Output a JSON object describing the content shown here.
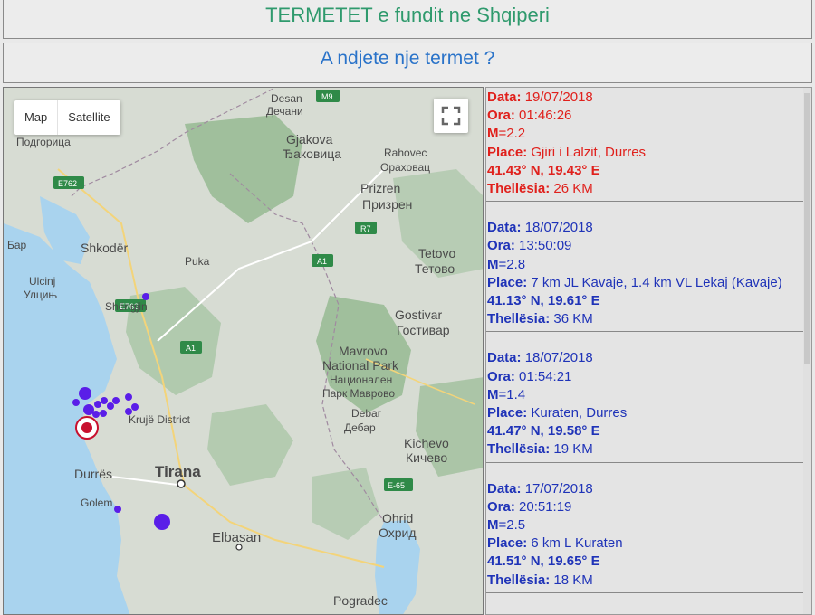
{
  "header": {
    "title": "TERMETET e fundit ne Shqiperi",
    "feel_link": "A ndjete nje termet ?"
  },
  "map": {
    "toggle": [
      "Map",
      "Satellite"
    ],
    "labels": {
      "desan": "Desan",
      "dechani": "Дечани",
      "podgorica": "Подгорица",
      "gjakova": "Gjakova",
      "djakovica": "Ђаковица",
      "rahovec": "Rahovec",
      "orahovac": "Ораховац",
      "prizren": "Prizren",
      "prizren_cyr": "Призрен",
      "shkoder": "Shkodër",
      "bar": "Бар",
      "puka": "Puka",
      "ulcinj": "Ulcinj",
      "ulcinj_cyr": "Улцињ",
      "tetovo": "Tetovo",
      "tetovo_cyr": "Тетово",
      "gostivar": "Gostivar",
      "gostivar_cyr": "Гостивар",
      "shengjin": "Shëngjin",
      "mavrovo1": "Mavrovo",
      "mavrovo2": "National Park",
      "mavrovo3": "Национален",
      "mavrovo4": "Парк Маврово",
      "kruje": "Krujë District",
      "debar": "Debar",
      "debar_cyr": "Дебар",
      "kichevo": "Kichevo",
      "kichevo_cyr": "Кичево",
      "durres": "Durrës",
      "tirana": "Tirana",
      "golem": "Golem",
      "ohrid": "Ohrid",
      "ohrid_cyr": "Охрид",
      "elbasan": "Elbasan",
      "pogradec": "Pogradec"
    },
    "roads": {
      "m9": "M9",
      "e762a": "E762",
      "e762b": "E762",
      "r7": "R7",
      "a1a": "A1",
      "a1b": "A1",
      "e65": "E-65"
    },
    "colors": {
      "marker": "#5a1ee8",
      "latest_marker": "#c8102e",
      "road_shield": "#2f8a48",
      "water": "#a9d3ee",
      "terrain": "#d7dcd3",
      "forest": "#8db58a"
    }
  },
  "events": [
    {
      "date_label": "Data:",
      "date": "19/07/2018",
      "time_label": "Ora:",
      "time": "01:46:26",
      "mag_label": "M",
      "mag": "=2.2",
      "place_label": "Place:",
      "place": "Gjiri i Lalzit, Durres",
      "coords": "41.43° N, 19.43° E",
      "depth_label": "Thellësia:",
      "depth": "26 KM",
      "color": "#e0201c"
    },
    {
      "date_label": "Data:",
      "date": "18/07/2018",
      "time_label": "Ora:",
      "time": "13:50:09",
      "mag_label": "M",
      "mag": "=2.8",
      "place_label": "Place:",
      "place": "7 km JL Kavaje, 1.4 km VL Lekaj (Kavaje)",
      "coords": "41.13° N, 19.61° E",
      "depth_label": "Thellësia:",
      "depth": "36 KM",
      "color": "#1f33b8"
    },
    {
      "date_label": "Data:",
      "date": "18/07/2018",
      "time_label": "Ora:",
      "time": "01:54:21",
      "mag_label": "M",
      "mag": "=1.4",
      "place_label": "Place:",
      "place": "Kuraten, Durres",
      "coords": "41.47° N, 19.58° E",
      "depth_label": "Thellësia:",
      "depth": "19 KM",
      "color": "#1f33b8"
    },
    {
      "date_label": "Data:",
      "date": "17/07/2018",
      "time_label": "Ora:",
      "time": "20:51:19",
      "mag_label": "M",
      "mag": "=2.5",
      "place_label": "Place:",
      "place": "6 km L Kuraten",
      "coords": "41.51° N, 19.65° E",
      "depth_label": "Thellësia:",
      "depth": "18 KM",
      "color": "#1f33b8"
    }
  ]
}
